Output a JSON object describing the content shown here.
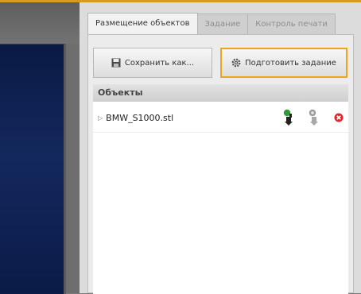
{
  "tabs": [
    {
      "label": "Размещение объектов",
      "active": true
    },
    {
      "label": "Задание",
      "active": false
    },
    {
      "label": "Контроль печати",
      "active": false
    }
  ],
  "toolbar": {
    "save_label": "Сохранить как...",
    "prepare_label": "Подготовить задание"
  },
  "objects_section": {
    "title": "Объекты",
    "items": [
      {
        "name": "BMW_S1000.stl"
      }
    ]
  },
  "colors": {
    "accent": "#f0a41c",
    "viewport": "#0d1f4f",
    "remove": "#e3262b"
  },
  "icons": [
    "floppy-disk-icon",
    "gear-icon",
    "expand-arrow-icon",
    "add-support-icon",
    "remove-support-icon",
    "delete-icon"
  ]
}
